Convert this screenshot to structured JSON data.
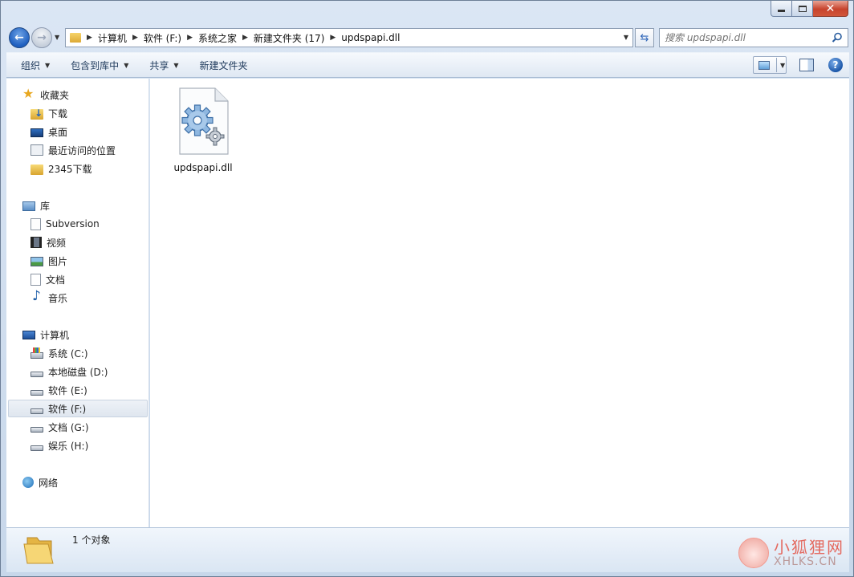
{
  "window": {
    "minimize_label": "",
    "maximize_label": "",
    "close_label": "✕"
  },
  "address": {
    "crumbs": [
      "计算机",
      "软件 (F:)",
      "系统之家",
      "新建文件夹 (17)",
      "updspapi.dll"
    ],
    "search_placeholder": "搜索 updspapi.dll"
  },
  "toolbar": {
    "organize": "组织",
    "include_library": "包含到库中",
    "share": "共享",
    "new_folder": "新建文件夹",
    "help": "?"
  },
  "nav": {
    "favorites": {
      "label": "收藏夹",
      "items": [
        "下载",
        "桌面",
        "最近访问的位置",
        "2345下载"
      ]
    },
    "libraries": {
      "label": "库",
      "items": [
        "Subversion",
        "视频",
        "图片",
        "文档",
        "音乐"
      ]
    },
    "computer": {
      "label": "计算机",
      "items": [
        "系统 (C:)",
        "本地磁盘 (D:)",
        "软件 (E:)",
        "软件 (F:)",
        "文档 (G:)",
        "娱乐 (H:)"
      ],
      "selected": "软件 (F:)"
    },
    "network": {
      "label": "网络"
    }
  },
  "content": {
    "files": [
      {
        "name": "updspapi.dll",
        "icon": "dll-gear-icon"
      }
    ]
  },
  "status": {
    "text": "1 个对象"
  },
  "watermark": {
    "cn": "小狐狸网",
    "en": "XHLKS.CN"
  }
}
